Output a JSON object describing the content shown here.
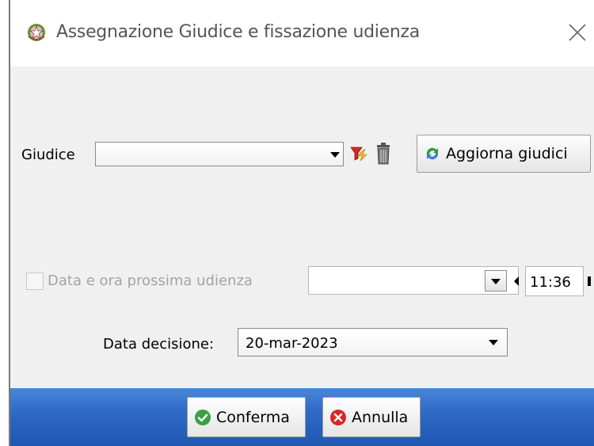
{
  "window": {
    "title": "Assegnazione Giudice e fissazione udienza",
    "close_symbol": "×",
    "app_icon": "italian-republic-emblem-icon",
    "close_icon": "close-icon"
  },
  "form": {
    "giudice": {
      "label": "Giudice",
      "value": "",
      "filter_icon": "filter-icon",
      "delete_icon": "trash-icon"
    },
    "aggiorna_button": {
      "label": "Aggiorna giudici",
      "icon": "refresh-icon"
    },
    "prossima_udienza": {
      "checkbox_label": "Data e ora prossima udienza",
      "checked": false,
      "enabled": false,
      "date_value": "",
      "time_value": "11:36"
    },
    "data_decisione": {
      "label": "Data decisione:",
      "value": "20-mar-2023"
    }
  },
  "footer": {
    "confirm_label": "Conferma",
    "confirm_icon": "check-icon",
    "cancel_label": "Annulla",
    "cancel_icon": "cancel-icon"
  },
  "colors": {
    "footer_blue": "#2e6ac6",
    "confirm_green": "#3aa043",
    "cancel_red": "#d9262b",
    "disabled_text": "#a4a4a4"
  }
}
